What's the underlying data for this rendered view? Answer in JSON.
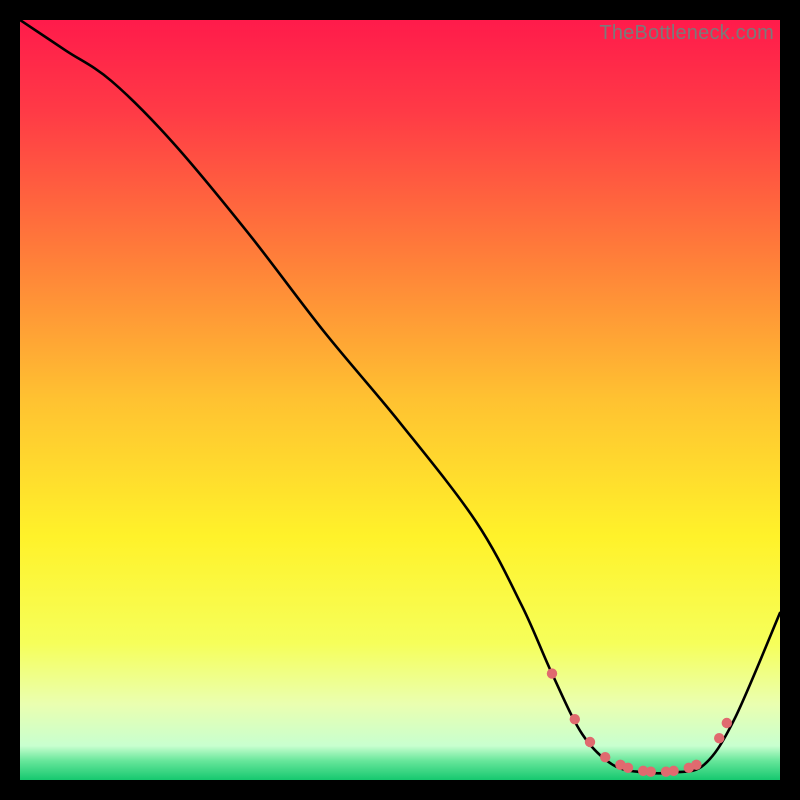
{
  "watermark": "TheBottleneck.com",
  "chart_data": {
    "type": "line",
    "title": "",
    "xlabel": "",
    "ylabel": "",
    "xlim": [
      0,
      100
    ],
    "ylim": [
      0,
      100
    ],
    "gradient_stops": [
      {
        "offset": 0.0,
        "color": "#ff1b4b"
      },
      {
        "offset": 0.12,
        "color": "#ff3a46"
      },
      {
        "offset": 0.3,
        "color": "#ff7a3a"
      },
      {
        "offset": 0.5,
        "color": "#ffc231"
      },
      {
        "offset": 0.68,
        "color": "#fff22a"
      },
      {
        "offset": 0.82,
        "color": "#f6ff5a"
      },
      {
        "offset": 0.9,
        "color": "#eaffb0"
      },
      {
        "offset": 0.955,
        "color": "#c8ffcf"
      },
      {
        "offset": 0.975,
        "color": "#66e69a"
      },
      {
        "offset": 1.0,
        "color": "#16c86f"
      }
    ],
    "series": [
      {
        "name": "bottleneck-curve",
        "x": [
          0,
          6,
          12,
          20,
          30,
          40,
          50,
          60,
          66,
          70,
          74,
          78,
          82,
          86,
          90,
          94,
          100
        ],
        "y": [
          100,
          96,
          92,
          84,
          72,
          59,
          47,
          34,
          23,
          14,
          6,
          2,
          1,
          1,
          2,
          8,
          22
        ]
      }
    ],
    "markers": {
      "name": "highlight-dots",
      "color": "#e06a6f",
      "x": [
        70,
        73,
        75,
        77,
        79,
        80,
        82,
        83,
        85,
        86,
        88,
        89,
        92,
        93
      ],
      "y": [
        14,
        8,
        5,
        3,
        2,
        1.6,
        1.2,
        1.1,
        1.1,
        1.2,
        1.6,
        2.0,
        5.5,
        7.5
      ]
    }
  }
}
